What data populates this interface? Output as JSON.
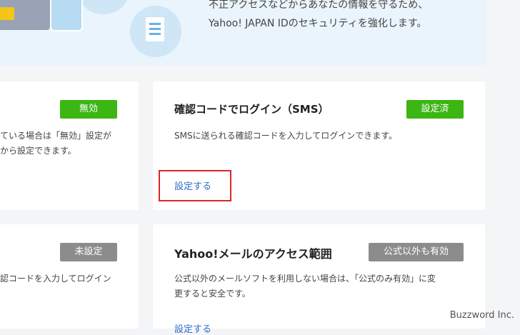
{
  "banner": {
    "line1": "不正アクセスなどからあなたの情報を守るため、",
    "line2": "Yahoo! JAPAN IDのセキュリティを強化します。"
  },
  "cards": {
    "top_left": {
      "badge": "無効",
      "body1": "ている場合は「無効」設定が",
      "body2": "から設定できます。"
    },
    "top_right": {
      "title": "確認コードでログイン（SMS）",
      "badge": "設定済",
      "body": "SMSに送られる確認コードを入力してログインできます。",
      "link": "設定する"
    },
    "bottom_left": {
      "badge": "未設定",
      "body1": "認コードを入力してログイン"
    },
    "bottom_right": {
      "title": "Yahoo!メールのアクセス範囲",
      "badge": "公式以外も有効",
      "body1": "公式以外のメールソフトを利用しない場合は、「公式のみ有効」に変",
      "body2": "更すると安全です。",
      "link": "設定する"
    }
  },
  "watermark": "Buzzword Inc.",
  "colors": {
    "badge_enabled": "#3bb613",
    "badge_disabled": "#8c8c8c",
    "link": "#2c6ecb",
    "highlight": "#d9262c"
  }
}
